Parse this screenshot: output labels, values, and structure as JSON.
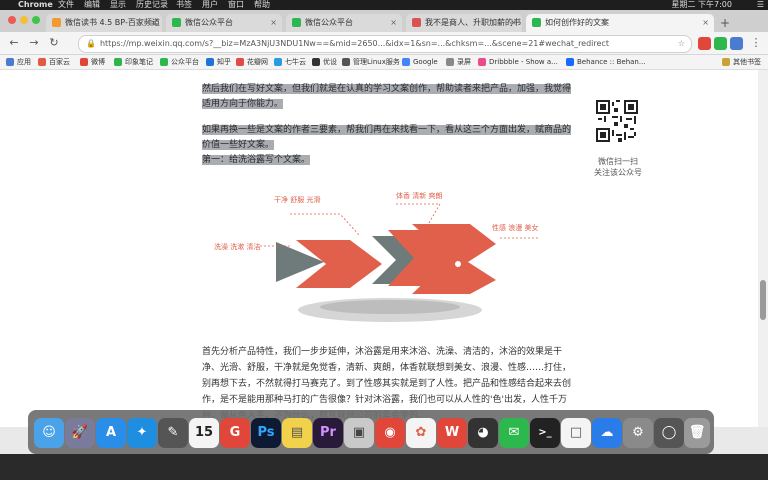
{
  "menubar": {
    "apple": "",
    "app_name": "Chrome",
    "menus": [
      "文件",
      "编辑",
      "显示",
      "历史记录",
      "书签",
      "用户",
      "窗口",
      "帮助"
    ],
    "clock": "星期二 下午7:00",
    "tray": "☰"
  },
  "tabs": [
    {
      "label": "微信读书 4.5 BP-百家频道",
      "color": "#f29a2e",
      "active": false
    },
    {
      "label": "微信公众平台",
      "color": "#2db84d",
      "active": false
    },
    {
      "label": "微信公众平台",
      "color": "#2db84d",
      "active": false
    },
    {
      "label": "我不是商人、升职加薪的书",
      "color": "#d9534f",
      "active": false
    },
    {
      "label": "如何创作好的文案",
      "color": "#2db84d",
      "active": true
    }
  ],
  "toolbar": {
    "back": "←",
    "forward": "→",
    "reload": "↻",
    "url": "https://mp.weixin.qq.com/s?__biz=MzA3NjU3NDU1Nw==&mid=2650...&idx=1&sn=...&chksm=...&scene=21#wechat_redirect",
    "lock": "🔒",
    "star": "☆",
    "menu": "⋮"
  },
  "bookmarks": [
    {
      "label": "应用",
      "color": "#4a7bd0"
    },
    {
      "label": "百家云",
      "color": "#e05a47"
    },
    {
      "label": "微博",
      "color": "#e0473a"
    },
    {
      "label": "印象笔记",
      "color": "#2fb34a"
    },
    {
      "label": "公众平台",
      "color": "#2db84d"
    },
    {
      "label": "知乎",
      "color": "#1f74d8"
    },
    {
      "label": "花瓣网",
      "color": "#e04a4a"
    },
    {
      "label": "七牛云",
      "color": "#2a9be0"
    },
    {
      "label": "优设",
      "color": "#333333"
    },
    {
      "label": "管理Linux服务",
      "color": "#555555"
    },
    {
      "label": "Google",
      "color": "#4285f4"
    },
    {
      "label": "录屏",
      "color": "#888888"
    },
    {
      "label": "Dribbble - Show a...",
      "color": "#ea4c89"
    },
    {
      "label": "Behance :: Behan...",
      "color": "#1769ff"
    }
  ],
  "bookmarks_other": "其他书签",
  "article": {
    "para1": "然后我们在写好文案，但我们就是在认真的学习文案创作，帮助读者来把产品，加强，我觉得适用方向于你能力。",
    "para2": "如果再换一些是文案的作者三要素，帮我们再在来找看一下，看从这三个方面出发，赋商品的价值一些好文案。",
    "para2b": "第一：给洗浴露写个文案。",
    "body": "首先分析产品特性，我们一步步延伸，沐浴露是用来沐浴、洗澡、清洁的，沐浴的效果是干净、光滑、舒服，干净就是免觉香，清新、爽朗，体香就联想到美女、浪漫、性感……打住，别再想下去，不然就得打马赛克了。到了性感其实就是到了人性。把产品和性感结合起来去创作，是不是能用那种马打的广告很像？针对沐浴露，我们也可以从人性的'色'出发，人性千万种，偏从色入手。不为什么，就互联网公司的年会学的。"
  },
  "diagram": {
    "label_left": "洗澡 洗漱 清洁",
    "label_top1": "干净 舒服 光滑",
    "label_top2": "体香 清新 爽朗",
    "label_right": "性感 浪漫 美女",
    "colors": {
      "gray": "#6f7a7a",
      "red": "#e0604b",
      "shadow": "#cfcfcf"
    }
  },
  "sidebar": {
    "qr_caption_line1": "微信扫一扫",
    "qr_caption_line2": "关注该公众号"
  },
  "dock": [
    {
      "name": "finder-icon",
      "glyph": "☺",
      "color": "#4aa3e8"
    },
    {
      "name": "launchpad-icon",
      "glyph": "🚀",
      "color": "#7a7a9a"
    },
    {
      "name": "appstore-icon",
      "glyph": "A",
      "color": "#2a8de8"
    },
    {
      "name": "safari-icon",
      "glyph": "✦",
      "color": "#1f8de0"
    },
    {
      "name": "pen-icon",
      "glyph": "✎",
      "color": "#555555"
    },
    {
      "name": "calendar-icon",
      "glyph": "15",
      "color": "#f4f4f4"
    },
    {
      "name": "app-g-icon",
      "glyph": "G",
      "color": "#e0473a"
    },
    {
      "name": "photoshop-icon",
      "glyph": "Ps",
      "color": "#0e1a33"
    },
    {
      "name": "notes-icon",
      "glyph": "▤",
      "color": "#f2d24a"
    },
    {
      "name": "premiere-icon",
      "glyph": "Pr",
      "color": "#2a1a3a"
    },
    {
      "name": "preview-icon",
      "glyph": "▣",
      "color": "#c9c9c9"
    },
    {
      "name": "chrome-icon",
      "glyph": "◉",
      "color": "#e0473a"
    },
    {
      "name": "photos-icon",
      "glyph": "✿",
      "color": "#f4f4f4"
    },
    {
      "name": "wps-icon",
      "glyph": "W",
      "color": "#e0473a"
    },
    {
      "name": "qq-icon",
      "glyph": "◕",
      "color": "#333333"
    },
    {
      "name": "wechat-icon",
      "glyph": "✉",
      "color": "#2db84d"
    },
    {
      "name": "terminal-icon",
      "glyph": ">_",
      "color": "#222222"
    },
    {
      "name": "app-white-icon",
      "glyph": "□",
      "color": "#f4f4f4"
    },
    {
      "name": "baidu-icon",
      "glyph": "☁",
      "color": "#2a7de8"
    },
    {
      "name": "settings-icon",
      "glyph": "⚙",
      "color": "#8a8a8a"
    },
    {
      "name": "cloud-icon",
      "glyph": "◯",
      "color": "#555555"
    },
    {
      "name": "trash-icon",
      "glyph": "🗑",
      "color": "#9a9a9a"
    }
  ]
}
